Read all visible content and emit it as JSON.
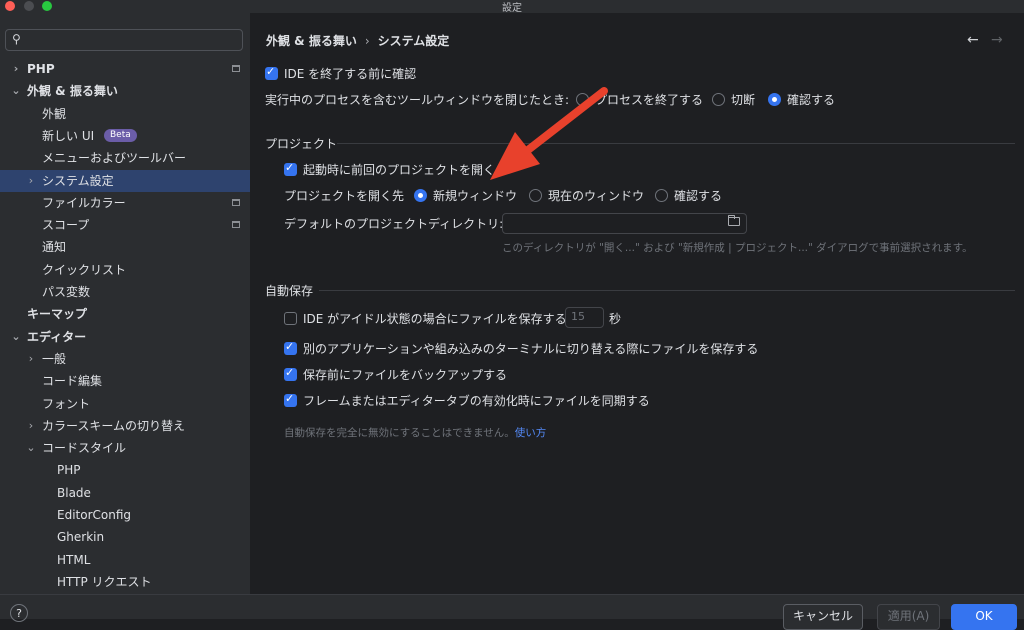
{
  "window": {
    "title": "設定"
  },
  "sidebar": {
    "search_placeholder": "",
    "items": [
      {
        "label": "PHP",
        "bold": true,
        "chevron": "right"
      },
      {
        "label": "外観 & 振る舞い",
        "bold": true,
        "chevron": "down"
      },
      {
        "label": "外観"
      },
      {
        "label": "新しい UI",
        "badge": "Beta"
      },
      {
        "label": "メニューおよびツールバー"
      },
      {
        "label": "システム設定",
        "chevron": "right",
        "selected": true
      },
      {
        "label": "ファイルカラー"
      },
      {
        "label": "スコープ"
      },
      {
        "label": "通知"
      },
      {
        "label": "クイックリスト"
      },
      {
        "label": "パス変数"
      },
      {
        "label": "キーマップ",
        "bold": true
      },
      {
        "label": "エディター",
        "bold": true,
        "chevron": "down"
      },
      {
        "label": "一般",
        "chevron": "right"
      },
      {
        "label": "コード編集"
      },
      {
        "label": "フォント"
      },
      {
        "label": "カラースキームの切り替え",
        "chevron": "right"
      },
      {
        "label": "コードスタイル",
        "chevron": "down"
      },
      {
        "label": "PHP"
      },
      {
        "label": "Blade"
      },
      {
        "label": "EditorConfig"
      },
      {
        "label": "Gherkin"
      },
      {
        "label": "HTML"
      },
      {
        "label": "HTTP リクエスト"
      }
    ]
  },
  "breadcrumb": {
    "parent": "外観 & 振る舞い",
    "separator": "›",
    "current": "システム設定"
  },
  "nav": {
    "back": "←",
    "forward": "→"
  },
  "general": {
    "confirm_exit_label": "IDE を終了する前に確認",
    "confirm_exit_checked": true,
    "process_close_label": "実行中のプロセスを含むツールウィンドウを閉じたとき:",
    "process_options": [
      "プロセスを終了する",
      "切断",
      "確認する"
    ],
    "process_selected": "確認する"
  },
  "project": {
    "section_title": "プロジェクト",
    "reopen_label": "起動時に前回のプロジェクトを開く",
    "reopen_checked": true,
    "open_target_label": "プロジェクトを開く先",
    "open_options": [
      "新規ウィンドウ",
      "現在のウィンドウ",
      "確認する"
    ],
    "open_selected": "新規ウィンドウ",
    "default_dir_label": "デフォルトのプロジェクトディレクトリ:",
    "default_dir_value": "",
    "default_dir_hint": "このディレクトリが \"開く...\" および \"新規作成 | プロジェクト...\" ダイアログで事前選択されます。"
  },
  "autosave": {
    "section_title": "自動保存",
    "idle_label": "IDE がアイドル状態の場合にファイルを保存する:",
    "idle_checked": false,
    "idle_seconds": "15",
    "idle_unit": "秒",
    "switch_label": "別のアプリケーションや組み込みのターミナルに切り替える際にファイルを保存する",
    "switch_checked": true,
    "backup_label": "保存前にファイルをバックアップする",
    "backup_checked": true,
    "sync_label": "フレームまたはエディタータブの有効化時にファイルを同期する",
    "sync_checked": true,
    "note": "自動保存を完全に無効にすることはできません。",
    "note_link": "使い方"
  },
  "footer": {
    "help": "?",
    "cancel": "キャンセル",
    "apply": "適用(A)",
    "ok": "OK"
  },
  "colors": {
    "accent": "#3574f0",
    "selection": "#2e436e",
    "annotation_arrow": "#e8412c",
    "beta_badge": "#6b5da8"
  },
  "icons": [
    "search-icon",
    "chevron-right-icon",
    "chevron-down-icon",
    "project-scope-icon",
    "folder-icon",
    "arrow-left-icon",
    "arrow-right-icon",
    "help-icon",
    "annotation-arrow"
  ]
}
